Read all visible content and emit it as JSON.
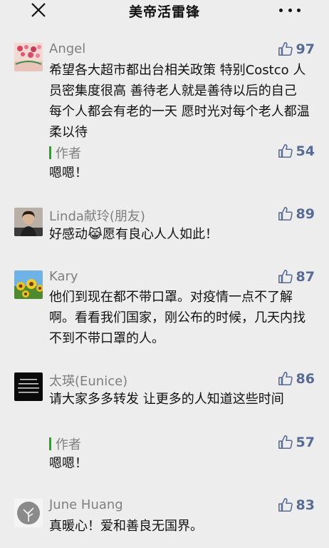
{
  "header": {
    "title": "美帝活雷锋"
  },
  "comments": [
    {
      "name": "Angel",
      "likes": "97",
      "text": "希望各大超市都出台相关政策 特别Costco 人员密集度很高 善待老人就是善待以后的自己 每个人都会有老的一天 愿时光对每个老人都温柔以待",
      "reply": {
        "tag": "作者",
        "likes": "54",
        "text": "嗯嗯！"
      }
    },
    {
      "name": "Linda献玲(朋友)",
      "likes": "89",
      "text": "好感动😹愿有良心人人如此！"
    },
    {
      "name": "Kary",
      "likes": "87",
      "text": "他们到现在都不带口罩。对疫情一点不了解啊。看看我们国家，刚公布的时候，几天内找不到不带口罩的人。"
    },
    {
      "name": "太瑛(Eunice)",
      "likes": "86",
      "text": "请大家多多转发 让更多的人知道这些时间",
      "reply": {
        "tag": "作者",
        "likes": "57",
        "text": "嗯嗯！"
      }
    },
    {
      "name": "June Huang",
      "likes": "83",
      "text": "真暖心！爱和善良无国界。"
    }
  ],
  "colors": {
    "background": "#ededed",
    "like": "#576b95",
    "author_bar": "#1aad19"
  }
}
